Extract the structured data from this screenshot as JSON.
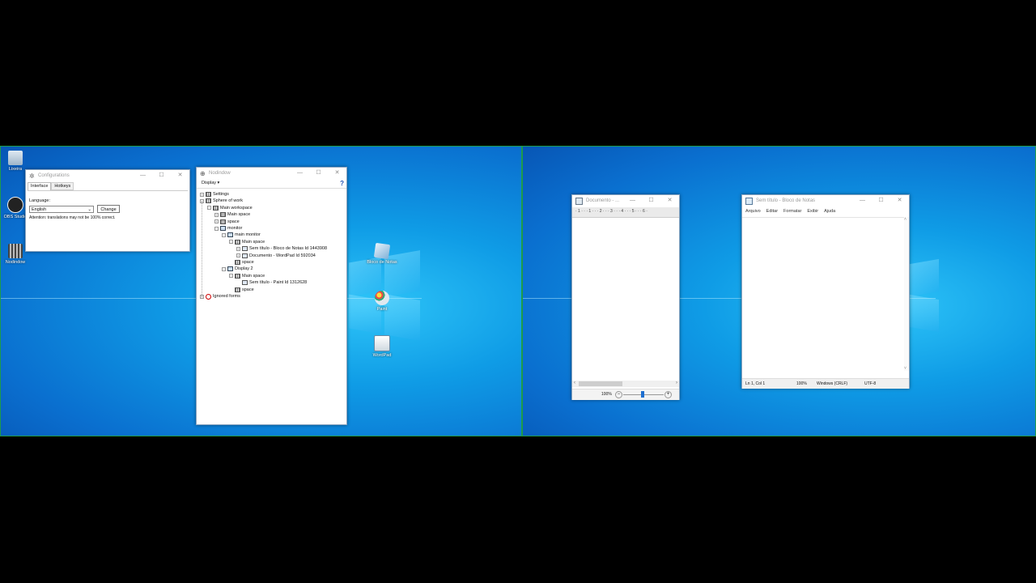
{
  "desktop_left": {
    "icons": [
      {
        "label": "Lixeira",
        "icon": "recycle-bin-icon"
      },
      {
        "label": "OBS Studio",
        "icon": "obs-icon"
      },
      {
        "label": "Nodindow",
        "icon": "nodindow-icon"
      },
      {
        "label": "Bloco de Notas",
        "icon": "notepad-icon"
      },
      {
        "label": "Paint",
        "icon": "paint-icon"
      },
      {
        "label": "WordPad",
        "icon": "wordpad-icon"
      }
    ]
  },
  "config_window": {
    "title": "Configurations",
    "tabs": [
      "Interface",
      "Hotkeys"
    ],
    "language_label": "Language:",
    "language_value": "English",
    "change_button": "Change",
    "attention": "Attention: translations may not be 100% correct."
  },
  "nodindow_window": {
    "title": "Nodindow",
    "menu_display": "Display ▾",
    "help": "?",
    "tree": [
      {
        "label": "Settings",
        "level": 0,
        "expander": "+",
        "icon": "gear"
      },
      {
        "label": "Sphere of work",
        "level": 0,
        "expander": "−",
        "icon": "globe"
      },
      {
        "label": "Main workspace",
        "level": 1,
        "expander": "−",
        "icon": "grid"
      },
      {
        "label": "Main space",
        "level": 2,
        "expander": "+",
        "icon": "grid"
      },
      {
        "label": "space",
        "level": 2,
        "expander": "+",
        "icon": "grid"
      },
      {
        "label": "monitor",
        "level": 2,
        "expander": "−",
        "icon": "monitors"
      },
      {
        "label": "main monitor",
        "level": 3,
        "expander": "−",
        "icon": "mon"
      },
      {
        "label": "Main space",
        "level": 4,
        "expander": "−",
        "icon": "grid"
      },
      {
        "label": "Sem título - Bloco de Notas Id 1443908",
        "level": 5,
        "expander": "+",
        "icon": "win"
      },
      {
        "label": "Documento - WordPad Id 592034",
        "level": 5,
        "expander": "+",
        "icon": "win"
      },
      {
        "label": "space",
        "level": 4,
        "expander": "",
        "icon": "grid"
      },
      {
        "label": "Display 2",
        "level": 3,
        "expander": "−",
        "icon": "mon"
      },
      {
        "label": "Main space",
        "level": 4,
        "expander": "−",
        "icon": "grid"
      },
      {
        "label": "Sem título - Paint Id 1312628",
        "level": 5,
        "expander": "",
        "icon": "win"
      },
      {
        "label": "space",
        "level": 4,
        "expander": "",
        "icon": "grid"
      },
      {
        "label": "Ignored forms",
        "level": 0,
        "expander": "+",
        "icon": "ban"
      }
    ]
  },
  "wordpad_window": {
    "title": "Documento - ...",
    "ruler": "· 1 · · · 1 · · · 2 · · · 3 · · · 4 · · · 5 · · · 6 ·",
    "zoom": "100%",
    "zoom_minus": "−",
    "zoom_plus": "+"
  },
  "notepad_window": {
    "title": "Sem título - Bloco de Notas",
    "menu": [
      "Arquivo",
      "Editar",
      "Formatar",
      "Exibir",
      "Ajuda"
    ],
    "status": [
      "Ln 1, Col 1",
      "100%",
      "Windows (CRLF)",
      "UTF-8"
    ]
  },
  "window_controls": {
    "minimize": "—",
    "maximize": "☐",
    "close": "✕"
  },
  "colors": {
    "desktop_blue": "#0f9ce6",
    "monitor_border": "#1e9b4a",
    "title_text": "#9a9a9a"
  }
}
